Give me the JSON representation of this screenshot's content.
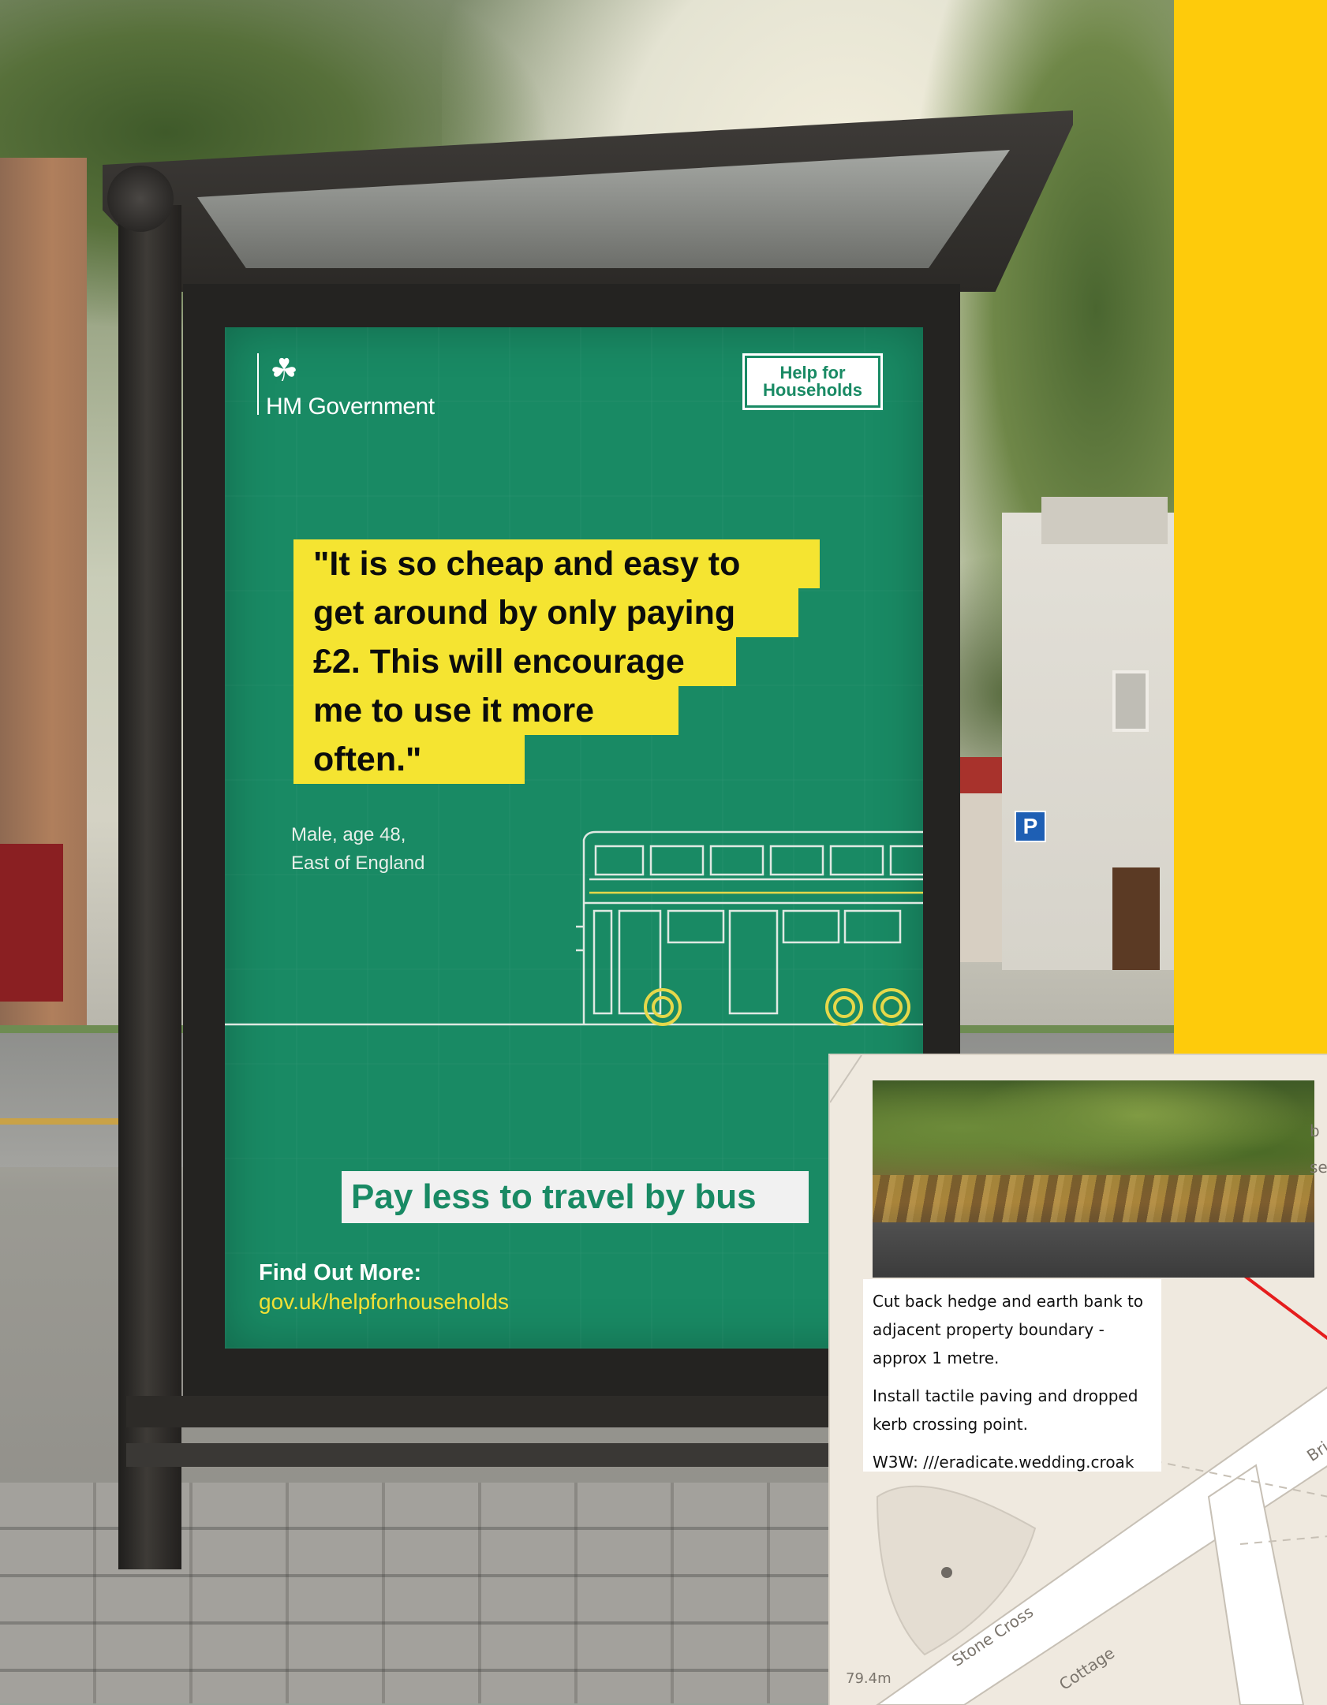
{
  "poster": {
    "gov_crest_glyph": "☘",
    "gov_name": "HM Government",
    "badge_line1": "Help for",
    "badge_line2": "Households",
    "quote_lines": [
      "\"It is so cheap and easy to",
      "get around by only paying",
      "£2. This will encourage",
      "me to use it more",
      "often.\""
    ],
    "attribution_line1": "Male, age 48,",
    "attribution_line2": "East of England",
    "cta": "Pay less to travel by bus",
    "find_label": "Find Out More:",
    "find_url": "gov.uk/helpforhouseholds",
    "colors": {
      "green": "#198a64",
      "yellow": "#f5e431",
      "cta_text": "#198a64"
    }
  },
  "street_sign": {
    "parking": "P"
  },
  "map_card": {
    "note_lines": [
      "Cut back hedge and earth bank to adjacent property boundary - approx 1 metre.",
      "Install tactile paving and dropped kerb crossing point.",
      "W3W: ///eradicate.wedding.croak"
    ],
    "elevation": "79.4m",
    "road_label_1": "Stone Cross",
    "road_label_2": "Cottage",
    "edge_fragment_1": "b",
    "edge_fragment_2": "se",
    "edge_fragment_3": "Bri"
  },
  "side_panel": {
    "color": "#fecb0b"
  }
}
